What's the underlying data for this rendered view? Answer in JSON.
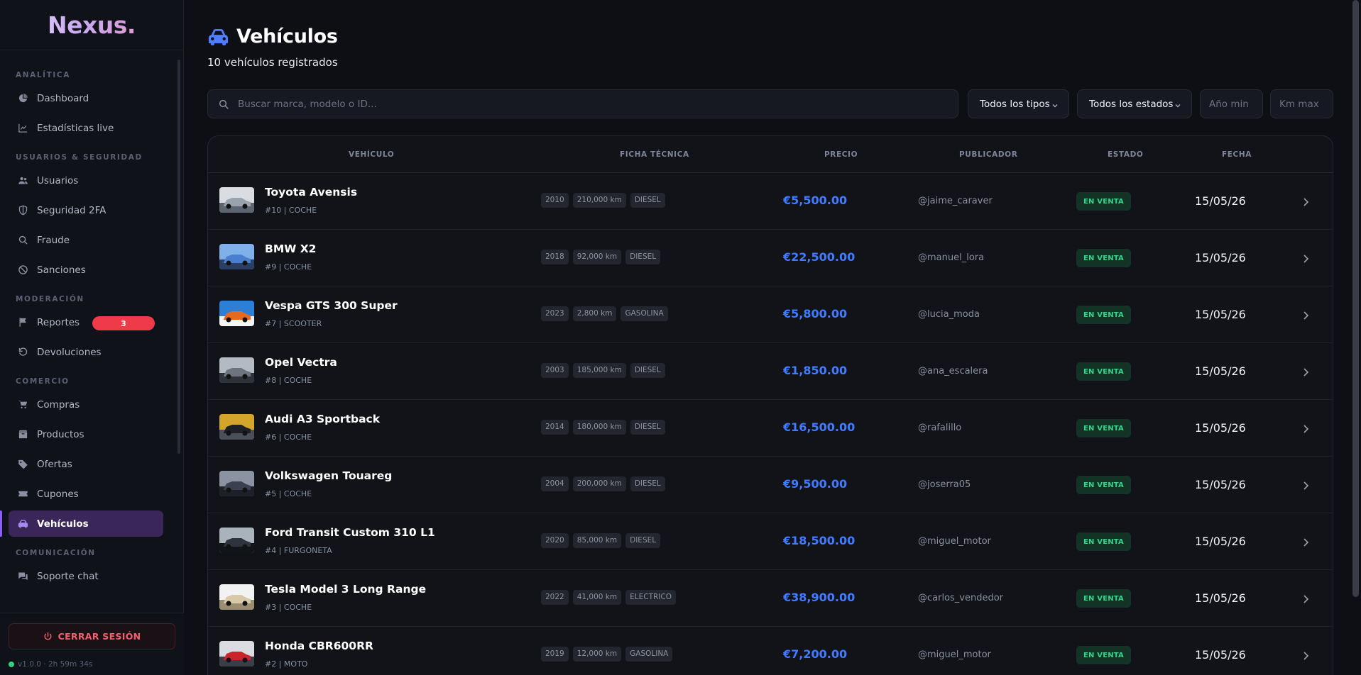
{
  "app": {
    "logo": "Nexus."
  },
  "sidebar": {
    "sections": [
      {
        "title": "ANALÍTICA",
        "items": [
          {
            "label": "Dashboard",
            "icon": "pie-chart-icon"
          },
          {
            "label": "Estadísticas live",
            "icon": "line-chart-icon"
          }
        ]
      },
      {
        "title": "USUARIOS & SEGURIDAD",
        "items": [
          {
            "label": "Usuarios",
            "icon": "users-icon"
          },
          {
            "label": "Seguridad 2FA",
            "icon": "shield-icon"
          },
          {
            "label": "Fraude",
            "icon": "search-icon"
          },
          {
            "label": "Sanciones",
            "icon": "ban-icon"
          }
        ]
      },
      {
        "title": "MODERACIÓN",
        "items": [
          {
            "label": "Reportes",
            "icon": "flag-icon",
            "badge": "3"
          },
          {
            "label": "Devoluciones",
            "icon": "undo-icon"
          }
        ]
      },
      {
        "title": "COMERCIO",
        "items": [
          {
            "label": "Compras",
            "icon": "cart-icon"
          },
          {
            "label": "Productos",
            "icon": "box-icon"
          },
          {
            "label": "Ofertas",
            "icon": "tag-icon"
          },
          {
            "label": "Cupones",
            "icon": "ticket-icon"
          },
          {
            "label": "Vehículos",
            "icon": "car-icon",
            "active": true
          }
        ]
      },
      {
        "title": "COMUNICACIÓN",
        "items": [
          {
            "label": "Soporte chat",
            "icon": "chat-icon"
          }
        ]
      }
    ],
    "logout_label": "CERRAR SESIÓN",
    "version": "v1.0.0 · 2h 59m 34s"
  },
  "header": {
    "title": "Vehículos",
    "subtitle": "10 vehículos registrados"
  },
  "filters": {
    "search_placeholder": "Buscar marca, modelo o ID...",
    "type_select": "Todos los tipos",
    "status_select": "Todos los estados",
    "year_min_placeholder": "Año min",
    "km_max_placeholder": "Km max"
  },
  "table": {
    "columns": [
      "VEHÍCULO",
      "FICHA TÉCNICA",
      "PRECIO",
      "PUBLICADOR",
      "ESTADO",
      "FECHA"
    ],
    "rows": [
      {
        "name": "Toyota Avensis",
        "meta": "#10 | COCHE",
        "year": "2010",
        "km": "210,000 km",
        "fuel": "DIESEL",
        "price": "€5,500.00",
        "publisher": "@jaime_caraver",
        "status": "EN VENTA",
        "date": "15/05/26"
      },
      {
        "name": "BMW X2",
        "meta": "#9 | COCHE",
        "year": "2018",
        "km": "92,000 km",
        "fuel": "DIESEL",
        "price": "€22,500.00",
        "publisher": "@manuel_lora",
        "status": "EN VENTA",
        "date": "15/05/26"
      },
      {
        "name": "Vespa GTS 300 Super",
        "meta": "#7 | SCOOTER",
        "year": "2023",
        "km": "2,800 km",
        "fuel": "GASOLINA",
        "price": "€5,800.00",
        "publisher": "@lucia_moda",
        "status": "EN VENTA",
        "date": "15/05/26"
      },
      {
        "name": "Opel Vectra",
        "meta": "#8 | COCHE",
        "year": "2003",
        "km": "185,000 km",
        "fuel": "DIESEL",
        "price": "€1,850.00",
        "publisher": "@ana_escalera",
        "status": "EN VENTA",
        "date": "15/05/26"
      },
      {
        "name": "Audi A3 Sportback",
        "meta": "#6 | COCHE",
        "year": "2014",
        "km": "180,000 km",
        "fuel": "DIESEL",
        "price": "€16,500.00",
        "publisher": "@rafalillo",
        "status": "EN VENTA",
        "date": "15/05/26"
      },
      {
        "name": "Volkswagen Touareg",
        "meta": "#5 | COCHE",
        "year": "2004",
        "km": "200,000 km",
        "fuel": "DIESEL",
        "price": "€9,500.00",
        "publisher": "@joserra05",
        "status": "EN VENTA",
        "date": "15/05/26"
      },
      {
        "name": "Ford Transit Custom 310 L1",
        "meta": "#4 | FURGONETA",
        "year": "2020",
        "km": "85,000 km",
        "fuel": "DIESEL",
        "price": "€18,500.00",
        "publisher": "@miguel_motor",
        "status": "EN VENTA",
        "date": "15/05/26"
      },
      {
        "name": "Tesla Model 3 Long Range",
        "meta": "#3 | COCHE",
        "year": "2022",
        "km": "41,000 km",
        "fuel": "ELECTRICO",
        "price": "€38,900.00",
        "publisher": "@carlos_vendedor",
        "status": "EN VENTA",
        "date": "15/05/26"
      },
      {
        "name": "Honda CBR600RR",
        "meta": "#2 | MOTO",
        "year": "2019",
        "km": "12,000 km",
        "fuel": "GASOLINA",
        "price": "€7,200.00",
        "publisher": "@miguel_motor",
        "status": "EN VENTA",
        "date": "15/05/26"
      }
    ]
  },
  "colors": {
    "accent": "#8b5cf6",
    "price": "#3f7cff",
    "status_green": "#37d48a",
    "danger": "#ef3a4a"
  }
}
